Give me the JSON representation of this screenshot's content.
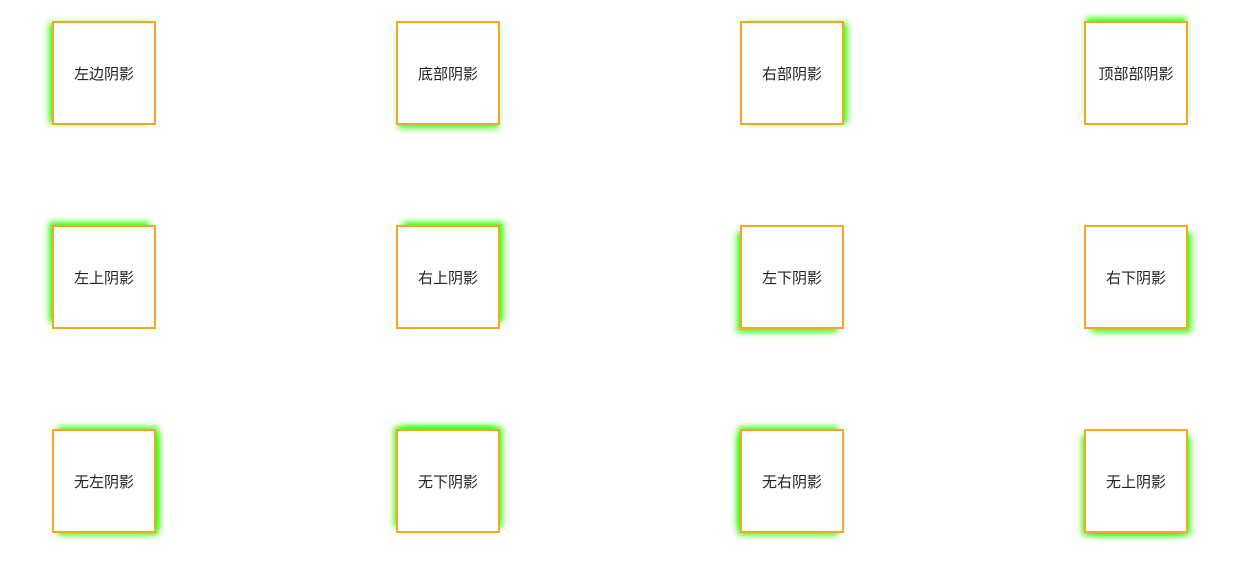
{
  "colors": {
    "border": "#f5a623",
    "shadow": "#33ff00",
    "text": "#222222",
    "background": "#ffffff"
  },
  "boxes": [
    {
      "label": "左边阴影"
    },
    {
      "label": "底部阴影"
    },
    {
      "label": "右部阴影"
    },
    {
      "label": "顶部部阴影"
    },
    {
      "label": "左上阴影"
    },
    {
      "label": "右上阴影"
    },
    {
      "label": "左下阴影"
    },
    {
      "label": "右下阴影"
    },
    {
      "label": "无左阴影"
    },
    {
      "label": "无下阴影"
    },
    {
      "label": "无右阴影"
    },
    {
      "label": "无上阴影"
    }
  ]
}
